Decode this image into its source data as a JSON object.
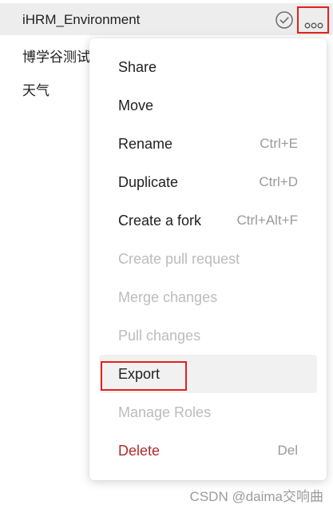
{
  "environments": [
    {
      "label": "iHRM_Environment",
      "selected": true
    },
    {
      "label": "博学谷测试"
    },
    {
      "label": "天气"
    }
  ],
  "icons": {
    "check": "check-circle-icon",
    "more": "more-horizontal-icon"
  },
  "menu": {
    "items": [
      {
        "label": "Share",
        "shortcut": "",
        "state": "enabled"
      },
      {
        "label": "Move",
        "shortcut": "",
        "state": "enabled"
      },
      {
        "label": "Rename",
        "shortcut": "Ctrl+E",
        "state": "enabled"
      },
      {
        "label": "Duplicate",
        "shortcut": "Ctrl+D",
        "state": "enabled"
      },
      {
        "label": "Create a fork",
        "shortcut": "Ctrl+Alt+F",
        "state": "enabled"
      },
      {
        "label": "Create pull request",
        "shortcut": "",
        "state": "disabled"
      },
      {
        "label": "Merge changes",
        "shortcut": "",
        "state": "disabled"
      },
      {
        "label": "Pull changes",
        "shortcut": "",
        "state": "disabled"
      },
      {
        "label": "Export",
        "shortcut": "",
        "state": "highlighted"
      },
      {
        "label": "Manage Roles",
        "shortcut": "",
        "state": "disabled"
      },
      {
        "label": "Delete",
        "shortcut": "Del",
        "state": "danger"
      }
    ]
  },
  "watermark": "CSDN @daima交响曲",
  "colors": {
    "annotation_red": "#e3211c",
    "danger_red": "#b02a2a",
    "disabled_text": "#bcbcbc",
    "shortcut_text": "#9a9a9a",
    "selected_row_bg": "#ededed"
  }
}
